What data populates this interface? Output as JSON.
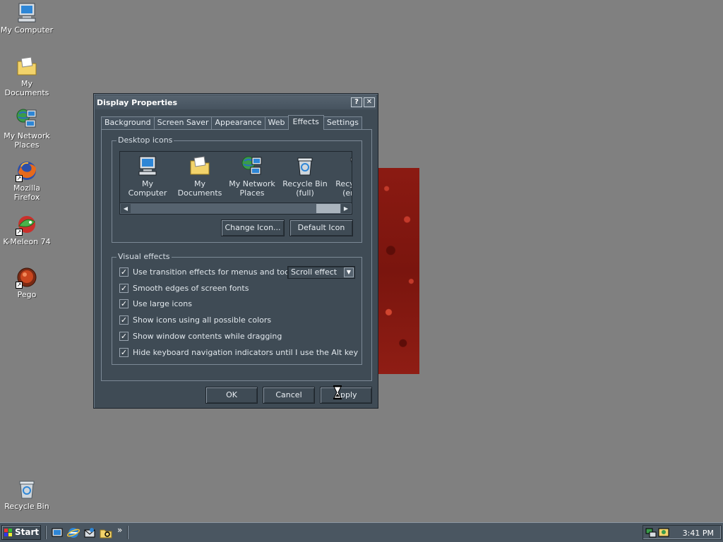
{
  "desktop": {
    "icons": [
      {
        "label": "My Computer",
        "icon": "computer-icon"
      },
      {
        "label": "My Documents",
        "icon": "folder-icon"
      },
      {
        "label": "My Network Places",
        "icon": "network-icon"
      },
      {
        "label": "Mozilla Firefox",
        "icon": "firefox-icon"
      },
      {
        "label": "K-Meleon 74",
        "icon": "kmeleon-icon"
      },
      {
        "label": "Pego",
        "icon": "pego-icon"
      },
      {
        "label": "Recycle Bin",
        "icon": "recycle-bin-icon"
      }
    ]
  },
  "dialog": {
    "title": "Display Properties",
    "help_btn": "?",
    "close_btn": "✕",
    "tabs": [
      "Background",
      "Screen Saver",
      "Appearance",
      "Web",
      "Effects",
      "Settings"
    ],
    "active_tab": "Effects",
    "desktop_icons_group": {
      "legend": "Desktop icons",
      "items": [
        {
          "label": "My Computer"
        },
        {
          "label": "My Documents"
        },
        {
          "label": "My Network Places"
        },
        {
          "label": "Recycle Bin (full)"
        },
        {
          "label": "Recycle Bin (empty)"
        }
      ],
      "change_icon": "Change Icon...",
      "default_icon": "Default Icon"
    },
    "visual_effects_group": {
      "legend": "Visual effects",
      "options": [
        {
          "label": "Use transition effects for menus and tooltips",
          "checked": true
        },
        {
          "label": "Smooth edges of screen fonts",
          "checked": true
        },
        {
          "label": "Use large icons",
          "checked": true
        },
        {
          "label": "Show icons using all possible colors",
          "checked": true
        },
        {
          "label": "Show window contents while dragging",
          "checked": true
        },
        {
          "label": "Hide keyboard navigation indicators until I use the Alt key",
          "checked": true
        }
      ],
      "transition_select": "Scroll effect"
    },
    "buttons": {
      "ok": "OK",
      "cancel": "Cancel",
      "apply": "Apply"
    }
  },
  "taskbar": {
    "start": "Start",
    "clock": "3:41 PM",
    "overflow": "»"
  },
  "colors": {
    "desktop": "#808080",
    "dialog_bg": "#3f4b55",
    "wallpaper": "#8b1a12"
  }
}
